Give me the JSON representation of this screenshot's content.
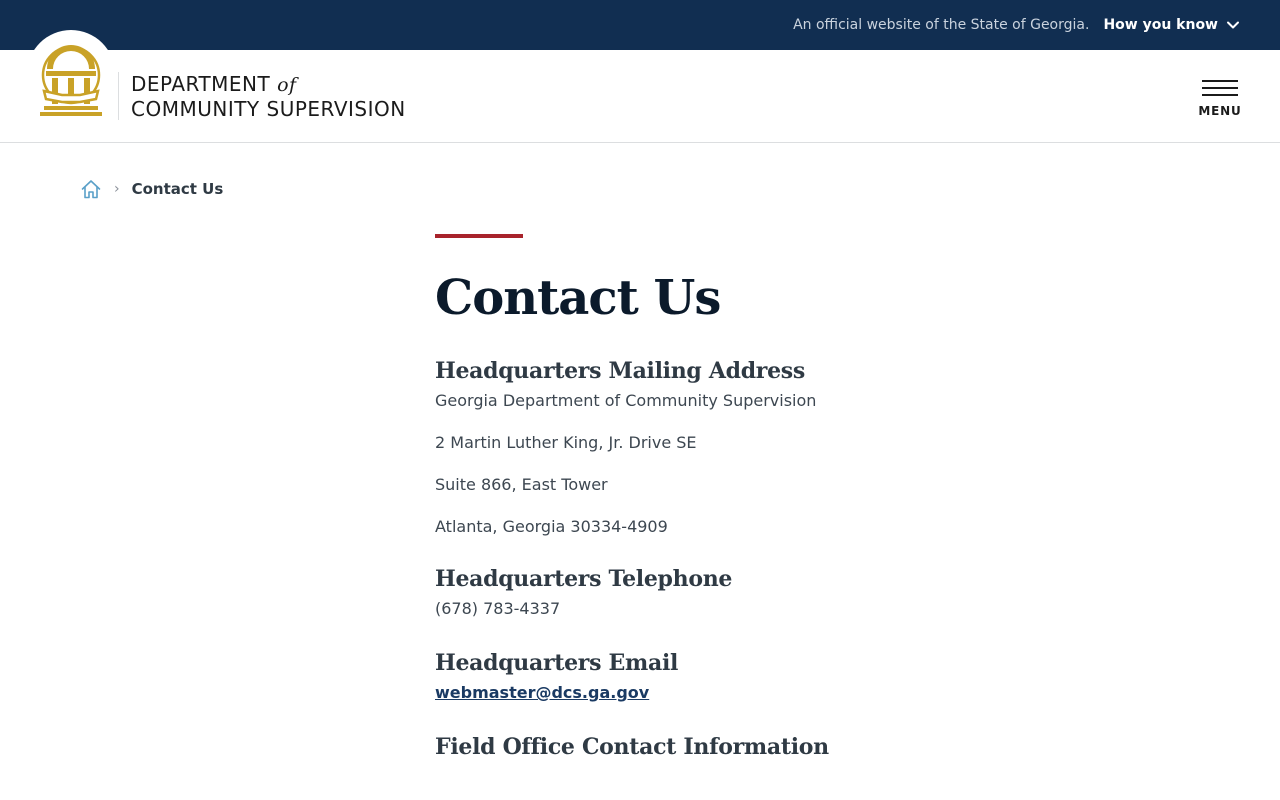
{
  "banner": {
    "official_text": "An official website of the State of Georgia.",
    "how_you_know": "How you know"
  },
  "header": {
    "agency_line1": "DEPARTMENT",
    "agency_of": "of",
    "agency_line2": "COMMUNITY SUPERVISION",
    "menu_label": "MENU"
  },
  "breadcrumb": {
    "current": "Contact Us"
  },
  "page": {
    "title": "Contact Us",
    "sections": {
      "mailing": {
        "heading": "Headquarters Mailing Address",
        "lines": [
          "Georgia Department of Community Supervision",
          "2 Martin Luther King, Jr. Drive SE",
          "Suite 866, East Tower",
          "Atlanta, Georgia 30334-4909"
        ]
      },
      "telephone": {
        "heading": "Headquarters Telephone",
        "value": "(678) 783-4337"
      },
      "email": {
        "heading": "Headquarters Email",
        "value": "webmaster@dcs.ga.gov"
      },
      "field": {
        "heading": "Field Office Contact Information"
      }
    }
  },
  "colors": {
    "banner_bg": "#112e51",
    "accent": "#a8232b",
    "seal_gold": "#c9a227",
    "link": "#1a3a63"
  },
  "icons": {
    "seal": "georgia-seal-icon",
    "chevron": "chevron-down-icon",
    "home": "home-icon",
    "menu": "hamburger-menu-icon"
  }
}
